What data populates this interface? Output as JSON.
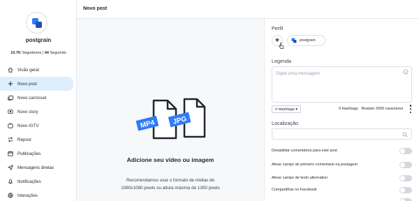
{
  "sidebar": {
    "brand": "postgrain",
    "stats": {
      "followers_count": "10.7K",
      "followers_label": "Seguidores",
      "separator": "|",
      "following_count": "44",
      "following_label": "Seguindo"
    },
    "items": [
      {
        "label": "Visão geral",
        "icon": "home-icon"
      },
      {
        "label": "Novo post",
        "icon": "plus-icon",
        "active": true
      },
      {
        "label": "Novo carrossel",
        "icon": "carousel-icon"
      },
      {
        "label": "Novo story",
        "icon": "story-icon"
      },
      {
        "label": "Novo IGTV",
        "icon": "igtv-icon"
      },
      {
        "label": "Repost",
        "icon": "repost-icon"
      },
      {
        "label": "Publicações",
        "icon": "calendar-icon"
      },
      {
        "label": "Mensagens diretas",
        "icon": "send-icon"
      },
      {
        "label": "Notificações",
        "icon": "bell-icon"
      },
      {
        "label": "Interações",
        "icon": "globe-icon"
      }
    ]
  },
  "header": {
    "title": "Novo post"
  },
  "upload": {
    "file_types": [
      "MP4",
      "JPG"
    ],
    "title": "Adicione seu vídeo ou imagem",
    "desc_line1": "Recomendamos usar o formato de mídias de",
    "desc_line2": "1080x1080 pixels ou altura máxima de 1350 pixels"
  },
  "panel": {
    "profile_label": "Perfil",
    "add_profile": "+",
    "profile_chip": "postgrain",
    "caption_label": "Legenda",
    "caption_placeholder": "Digite uma mensagem",
    "hashtags_button": "# Hashtags ▾",
    "hashtag_count": "0 Hashtags",
    "chars_remaining": "Restam 2000 caracteres",
    "location_label": "Localização",
    "options": [
      "Desabilitar comentários para este post",
      "Ativar campo de primeiro comentário na postagem",
      "Ativar campo de texto alternativo",
      "Compartilhar no Facebook"
    ]
  },
  "colors": {
    "brand_blue": "#2f7cf6",
    "active_bg": "#dfeefd",
    "toggle_off": "#d4d7dd"
  }
}
